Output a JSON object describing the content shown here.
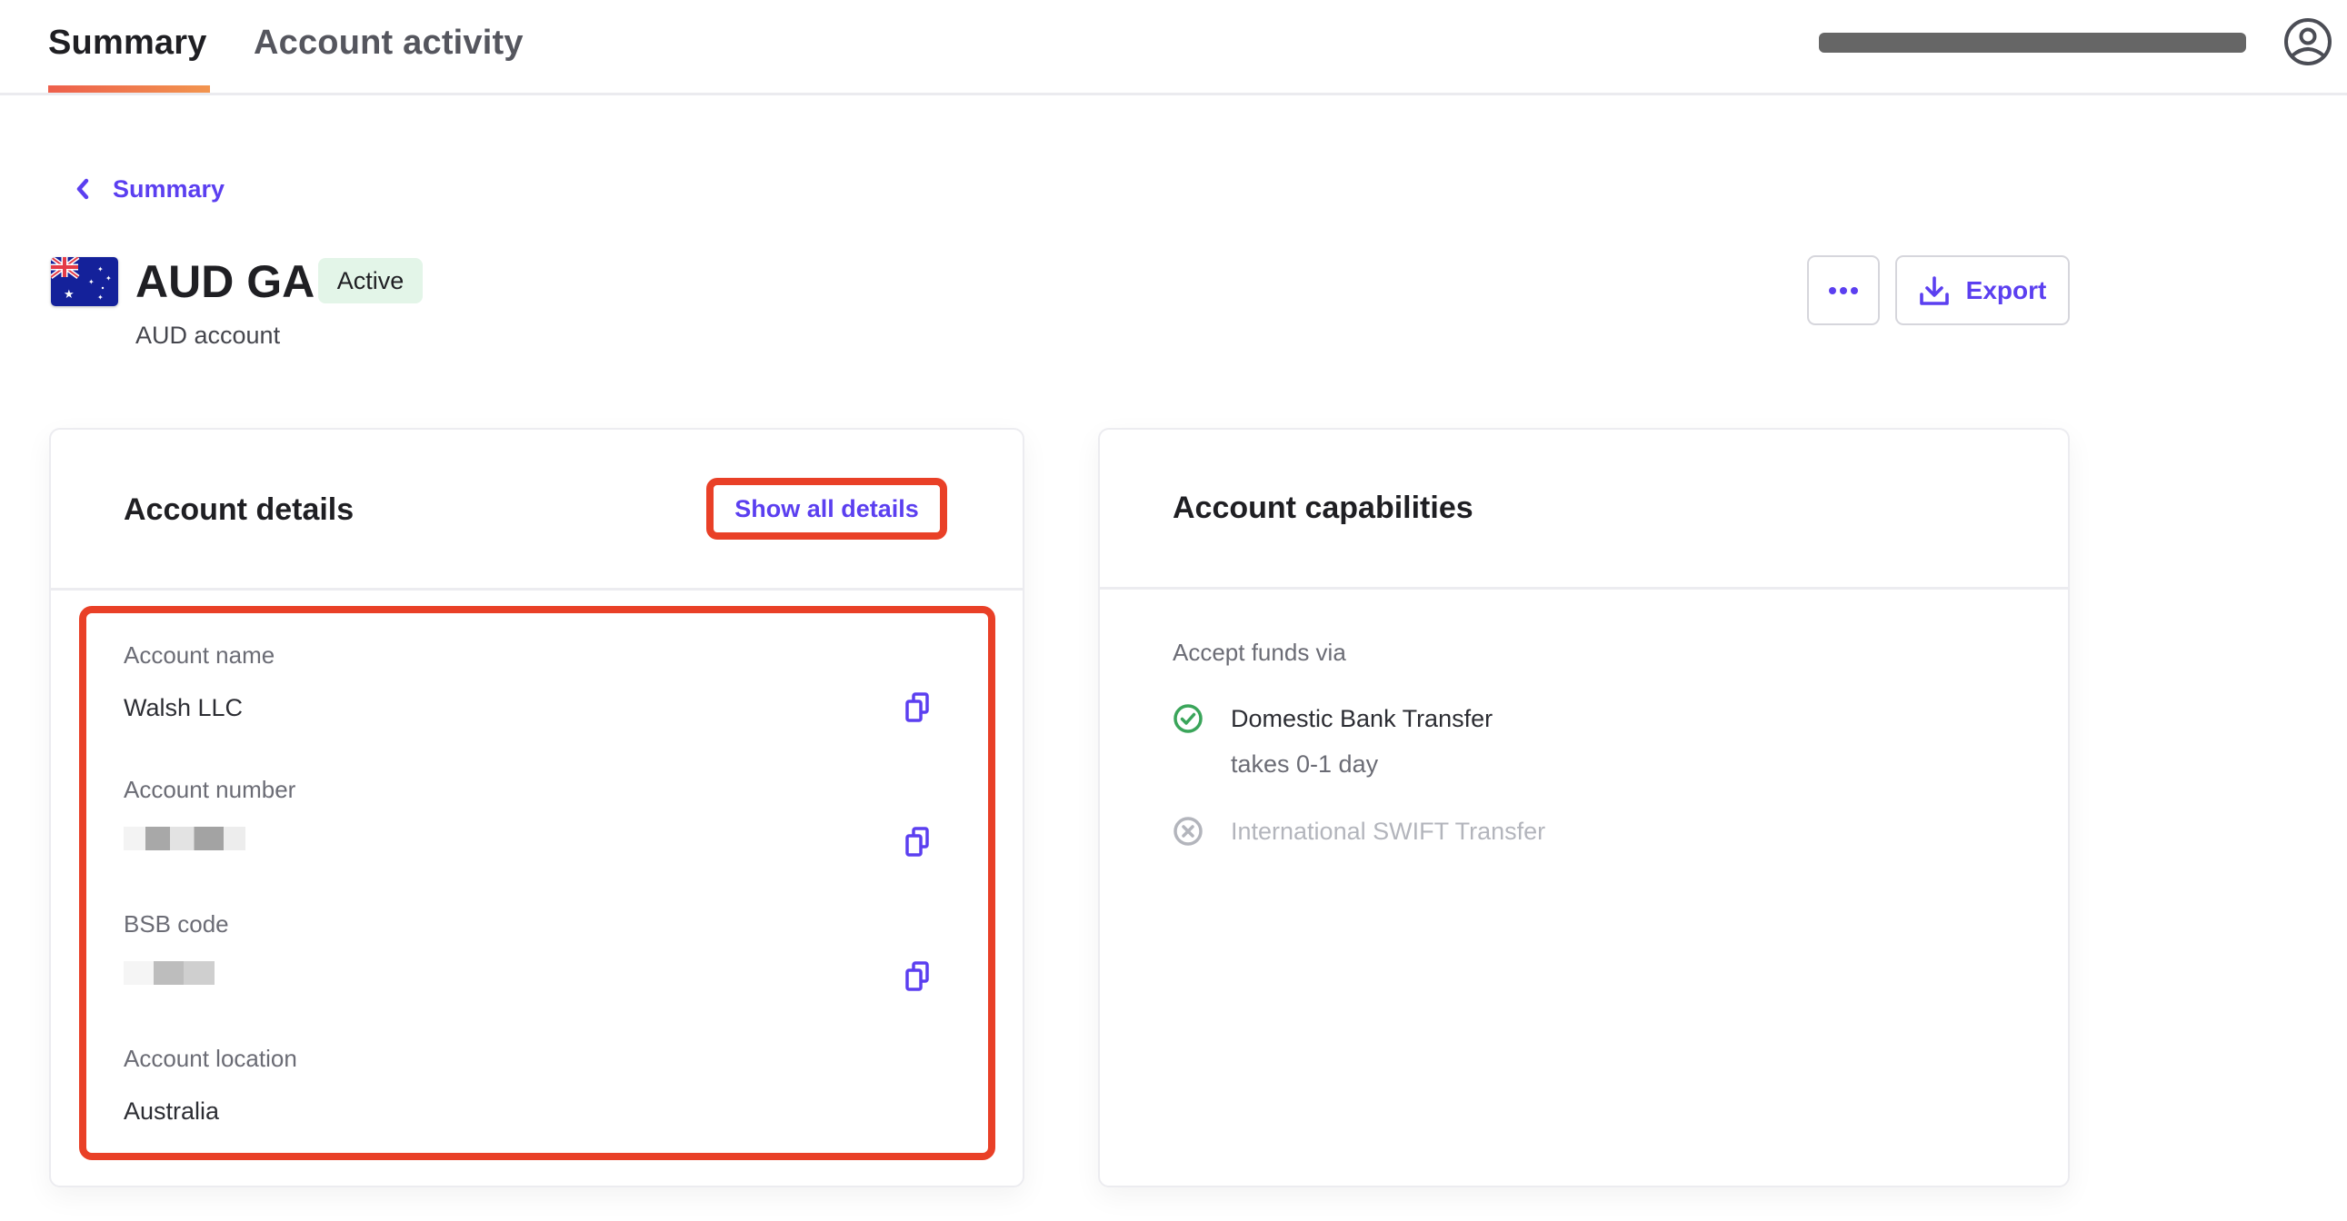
{
  "nav": {
    "tabs": [
      {
        "label": "Summary",
        "active": true
      },
      {
        "label": "Account activity",
        "active": false
      }
    ],
    "user_email": "[redacted email]",
    "user_icon": "user-circle-icon"
  },
  "breadcrumb": {
    "icon": "chevron-left-icon",
    "label": "Summary"
  },
  "account": {
    "flag_icon": "australia-flag-icon",
    "title": "AUD GA",
    "status": "Active",
    "subtitle": "AUD account",
    "actions": {
      "more_icon": "more-horizontal-icon",
      "export_icon": "download-icon",
      "export_label": "Export"
    }
  },
  "account_details": {
    "title": "Account details",
    "show_all_label": "Show all details",
    "fields": [
      {
        "label": "Account name",
        "value": "Walsh LLC",
        "copyable": true,
        "redacted": false
      },
      {
        "label": "Account number",
        "value": "[redacted]",
        "copyable": true,
        "redacted": true
      },
      {
        "label": "BSB code",
        "value": "[redacted]",
        "copyable": true,
        "redacted": true
      },
      {
        "label": "Account location",
        "value": "Australia",
        "copyable": false,
        "redacted": false
      }
    ],
    "copy_icon": "copy-icon"
  },
  "account_capabilities": {
    "title": "Account capabilities",
    "section_label": "Accept funds via",
    "methods": [
      {
        "name": "Domestic Bank Transfer",
        "note": "takes 0-1 day",
        "enabled": true,
        "icon": "check-circle-icon"
      },
      {
        "name": "International SWIFT Transfer",
        "note": "",
        "enabled": false,
        "icon": "x-circle-icon"
      }
    ]
  },
  "colors": {
    "accent": "#5b3ff0",
    "tab_underline_start": "#ee5f4c",
    "tab_underline_end": "#f2954f",
    "active_badge_bg": "#e3f5e8",
    "success": "#3aa55a",
    "disabled": "#b3b5bc",
    "annotation_red": "#e94027"
  }
}
